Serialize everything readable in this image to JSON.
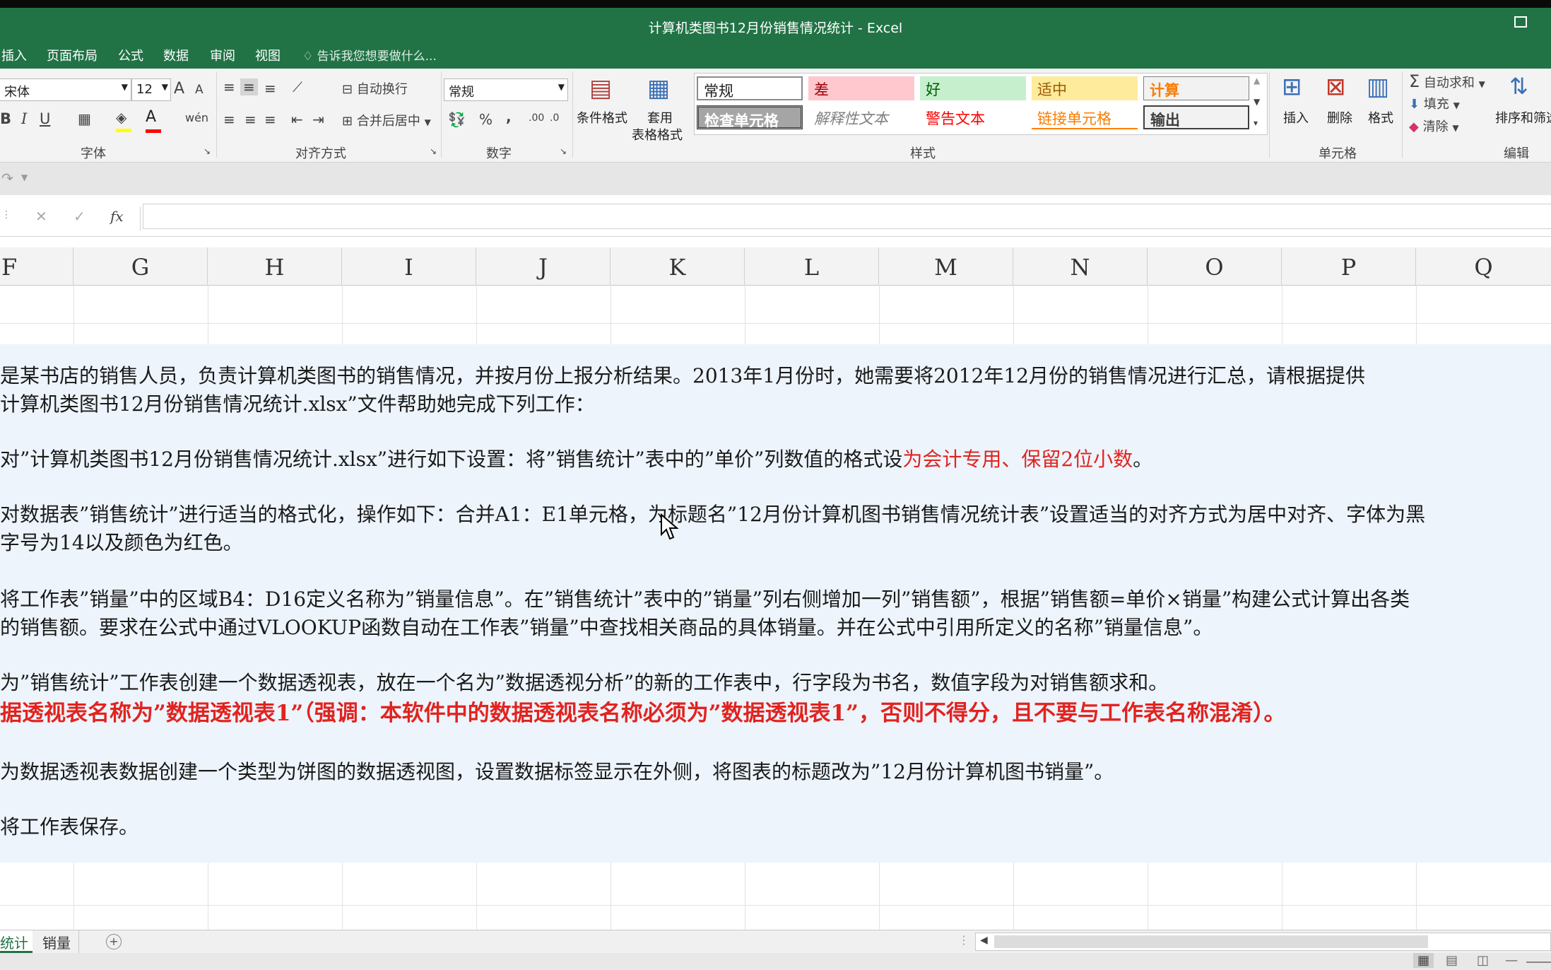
{
  "window": {
    "title": "计算机类图书12月份销售情况统计 - Excel"
  },
  "menu": {
    "items": [
      "插入",
      "页面布局",
      "公式",
      "数据",
      "审阅",
      "视图"
    ],
    "tell_me": "告诉我您想要做什么..."
  },
  "ribbon": {
    "font": {
      "name": "宋体",
      "size": "12",
      "bold": "B",
      "italic": "I",
      "underline": "U",
      "grow": "A",
      "shrink": "A",
      "label": "字体"
    },
    "align": {
      "wrap": "自动换行",
      "merge": "合并后居中",
      "label": "对齐方式"
    },
    "number": {
      "format": "常规",
      "percent": "%",
      "comma": ",",
      "label": "数字"
    },
    "styles": {
      "cond_format": "条件格式",
      "table_format_1": "套用",
      "table_format_2": "表格格式",
      "cells_row1": [
        "常规",
        "差",
        "好",
        "适中",
        "计算"
      ],
      "cells_row2": [
        "检查单元格",
        "解释性文本",
        "警告文本",
        "链接单元格",
        "输出"
      ],
      "label": "样式"
    },
    "cells": {
      "insert": "插入",
      "delete": "删除",
      "format": "格式",
      "label": "单元格"
    },
    "editing": {
      "autosum": "自动求和",
      "fill": "填充",
      "clear": "清除",
      "sort": "排序和筛选",
      "label": "编辑"
    }
  },
  "formula_bar": {
    "cancel": "✕",
    "enter": "✓",
    "fx": "fx",
    "value": ""
  },
  "columns": [
    "F",
    "G",
    "H",
    "I",
    "J",
    "K",
    "L",
    "M",
    "N",
    "O",
    "P",
    "Q"
  ],
  "content": {
    "l1": "是某书店的销售人员，负责计算机类图书的销售情况，并按月份上报分析结果。2013年1月份时，她需要将2012年12月份的销售情况进行汇总，请根据提供",
    "l2": "计算机类图书12月份销售情况统计.xlsx”文件帮助她完成下列工作：",
    "l3a": "对”计算机类图书12月份销售情况统计.xlsx”进行如下设置：将”销售统计”表中的”单价”列数值的格式设",
    "l3b": "为会计专用、保留2位小数",
    "l3c": "。",
    "l4": "对数据表”销售统计”进行适当的格式化，操作如下：合并A1：E1单元格，为标题名”12月份计算机图书销售情况统计表”设置适当的对齐方式为居中对齐、字体为黑",
    "l5": "字号为14以及颜色为红色。",
    "l6": "将工作表”销量”中的区域B4：D16定义名称为”销量信息”。在”销售统计”表中的”销量”列右侧增加一列”销售额”，根据”销售额=单价×销量”构建公式计算出各类",
    "l7": "的销售额。要求在公式中通过VLOOKUP函数自动在工作表”销量”中查找相关商品的具体销量。并在公式中引用所定义的名称”销量信息”。",
    "l8": "为”销售统计”工作表创建一个数据透视表，放在一个名为”数据透视分析”的新的工作表中，行字段为书名，数值字段为对销售额求和。",
    "l9": "据透视表名称为”数据透视表1”（强调：本软件中的数据透视表名称必须为”数据透视表1”，否则不得分，且不要与工作表名称混淆）。",
    "l10": "为数据透视表数据创建一个类型为饼图的数据透视图，设置数据标签显示在外侧，将图表的标题改为”12月份计算机图书销量”。",
    "l11": "将工作表保存。"
  },
  "sheets": {
    "tab1": "统计",
    "tab2": "销量",
    "add": "+"
  },
  "colors": {
    "excel_green": "#217346",
    "red_text": "#e1231f",
    "box_bg": "#edf4fc"
  }
}
